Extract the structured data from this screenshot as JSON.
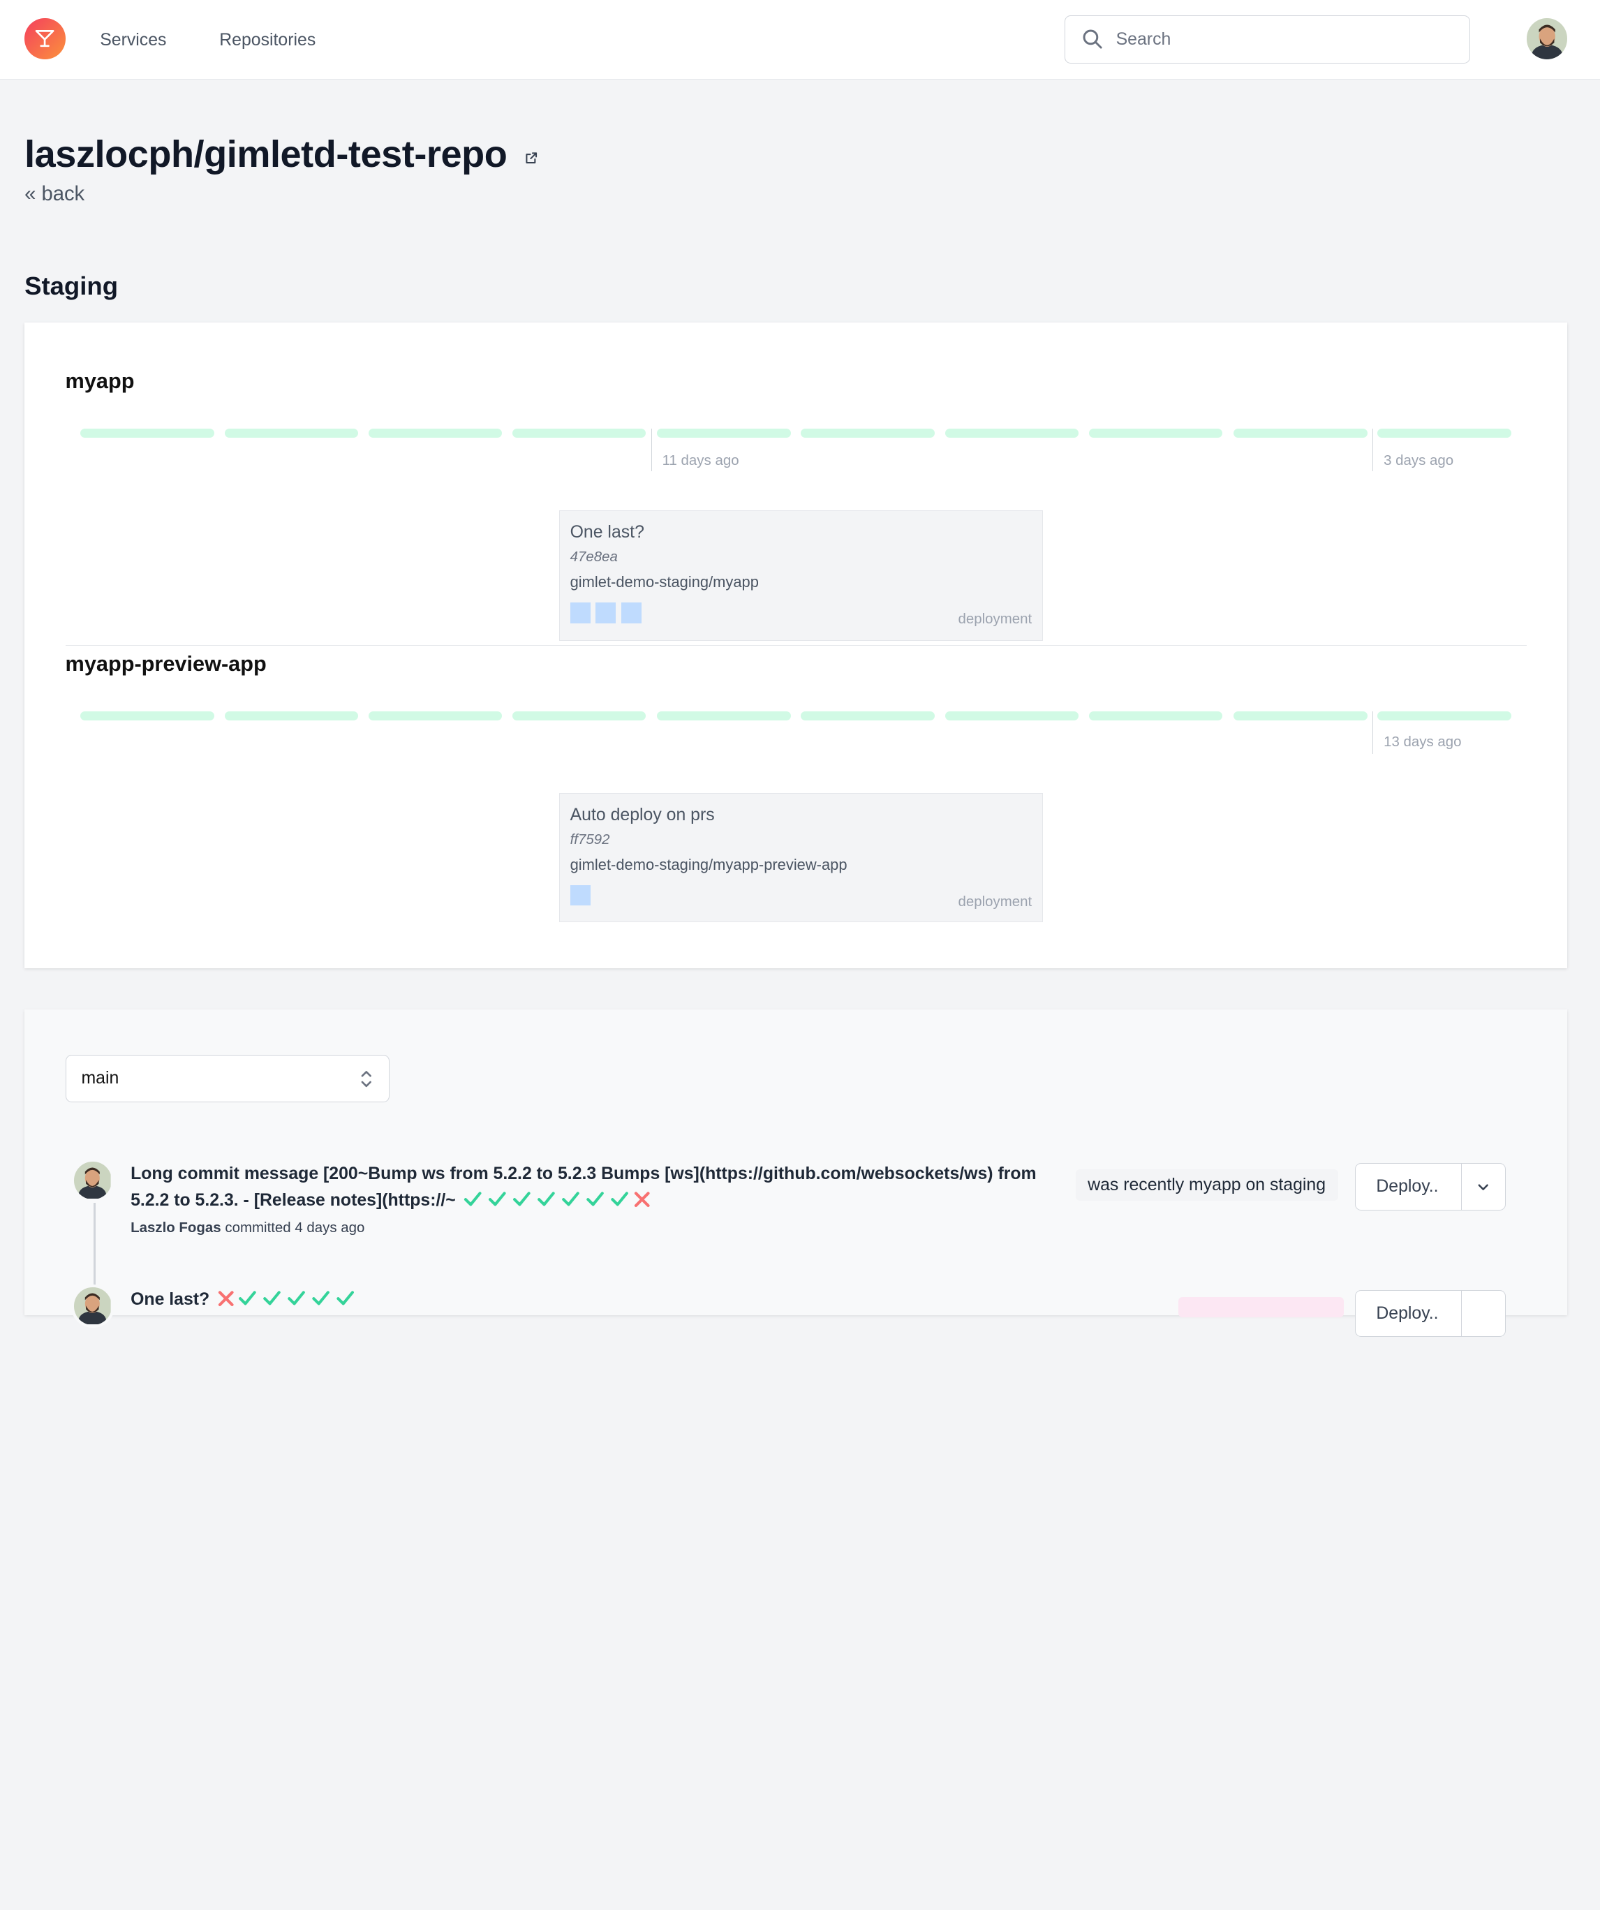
{
  "nav": {
    "items": [
      "Services",
      "Repositories"
    ],
    "search_placeholder": "Search"
  },
  "repo": {
    "title": "laszlocph/gimletd-test-repo",
    "back_label": "« back"
  },
  "environment": {
    "name": "Staging",
    "apps": [
      {
        "name": "myapp",
        "tick_labels": [
          "11 days ago",
          "3 days ago"
        ],
        "deployment": {
          "title": "One last?",
          "sha": "47e8ea",
          "target": "gimlet-demo-staging/myapp",
          "kind": "deployment",
          "pods": 3
        }
      },
      {
        "name": "myapp-preview-app",
        "tick_labels": [
          "13 days ago"
        ],
        "deployment": {
          "title": "Auto deploy on prs",
          "sha": "ff7592",
          "target": "gimlet-demo-staging/myapp-preview-app",
          "kind": "deployment",
          "pods": 1
        }
      }
    ]
  },
  "commits": {
    "branch": "main",
    "items": [
      {
        "message": "Long commit message [200~Bump ws from 5.2.2 to 5.2.3 Bumps [ws](https://github.com/websockets/ws) from 5.2.2 to 5.2.3. - [Release notes](https://~",
        "checks": [
          "pass",
          "pass",
          "pass",
          "pass",
          "pass",
          "pass",
          "pass",
          "fail"
        ],
        "author": "Laszlo Fogas",
        "meta": "committed 4 days ago",
        "badge": "was recently myapp on staging",
        "deploy_label": "Deploy.."
      },
      {
        "message": "One last?",
        "checks": [
          "fail",
          "pass",
          "pass",
          "pass",
          "pass",
          "pass"
        ],
        "deploy_label": "Deploy.."
      }
    ]
  },
  "colors": {
    "accent_gradient_start": "#f43f5e",
    "accent_gradient_end": "#fb923c",
    "bar": "#d1fae5",
    "pod": "#bfdbfe",
    "check_pass": "#34d399",
    "check_fail": "#f87171"
  }
}
